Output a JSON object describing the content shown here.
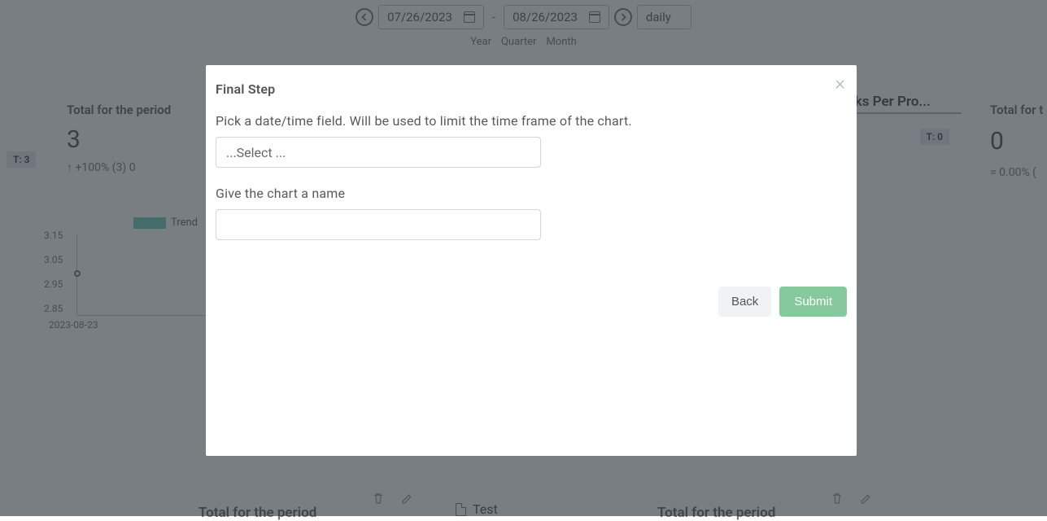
{
  "date_range": {
    "start": "07/26/2023",
    "end": "08/26/2023",
    "interval": "daily",
    "separator": "-",
    "periods": [
      "Year",
      "Quarter",
      "Month"
    ]
  },
  "t_label_left": "T: 3",
  "t_label_right": "T: 0",
  "summary_left": {
    "title": "Total for the period",
    "value": "3",
    "change": "+100% (3) 0"
  },
  "summary_right_title_trunc": "sks Per Pro...",
  "summary_right": {
    "title": "Total for t",
    "value": "0",
    "change": "0.00% ("
  },
  "chart": {
    "legend_label": "Trend",
    "y_ticks": [
      "3.15",
      "3.05",
      "2.95",
      "2.85"
    ],
    "x_label": "2023-08-23"
  },
  "chart_data": {
    "type": "line",
    "title": "",
    "xlabel": "",
    "ylabel": "",
    "ylim": [
      2.85,
      3.15
    ],
    "series": [
      {
        "name": "Trend",
        "x": [
          "2023-08-23"
        ],
        "values": [
          3.0
        ]
      }
    ]
  },
  "bottom": {
    "left_title": "Total for the period",
    "mid_title": "Test",
    "right_title": "Total for the period"
  },
  "modal": {
    "title": "Final Step",
    "label_date_field": "Pick a date/time field. Will be used to limit the time frame of the chart.",
    "select_placeholder": "...Select ...",
    "label_chart_name": "Give the chart a name",
    "chart_name_value": "",
    "back_label": "Back",
    "submit_label": "Submit"
  }
}
